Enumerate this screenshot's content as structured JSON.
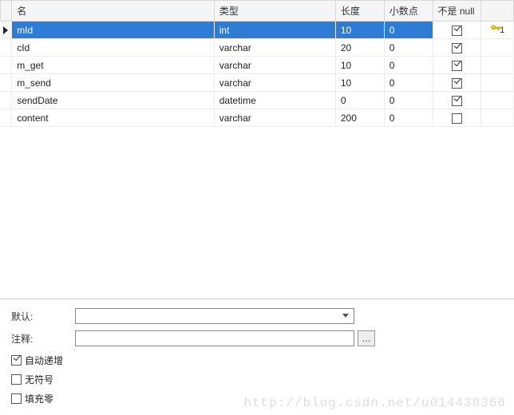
{
  "columns": {
    "name": "名",
    "type": "类型",
    "length": "长度",
    "decimals": "小数点",
    "not_null": "不是 null"
  },
  "rows": [
    {
      "name": "mId",
      "type": "int",
      "length": "10",
      "decimals": "0",
      "not_null": true,
      "pk": true,
      "selected": true
    },
    {
      "name": "cId",
      "type": "varchar",
      "length": "20",
      "decimals": "0",
      "not_null": true,
      "pk": false,
      "selected": false
    },
    {
      "name": "m_get",
      "type": "varchar",
      "length": "10",
      "decimals": "0",
      "not_null": true,
      "pk": false,
      "selected": false
    },
    {
      "name": "m_send",
      "type": "varchar",
      "length": "10",
      "decimals": "0",
      "not_null": true,
      "pk": false,
      "selected": false
    },
    {
      "name": "sendDate",
      "type": "datetime",
      "length": "0",
      "decimals": "0",
      "not_null": true,
      "pk": false,
      "selected": false
    },
    {
      "name": "content",
      "type": "varchar",
      "length": "200",
      "decimals": "0",
      "not_null": false,
      "pk": false,
      "selected": false
    }
  ],
  "form": {
    "default_label": "默认:",
    "comment_label": "注释:",
    "default_value": "",
    "comment_value": ""
  },
  "options": {
    "auto_increment": {
      "label": "自动递增",
      "checked": true
    },
    "unsigned": {
      "label": "无符号",
      "checked": false
    },
    "zerofill": {
      "label": "填充零",
      "checked": false
    }
  },
  "pk_index": "1",
  "watermark": "http://blog.csdn.net/u014430366"
}
